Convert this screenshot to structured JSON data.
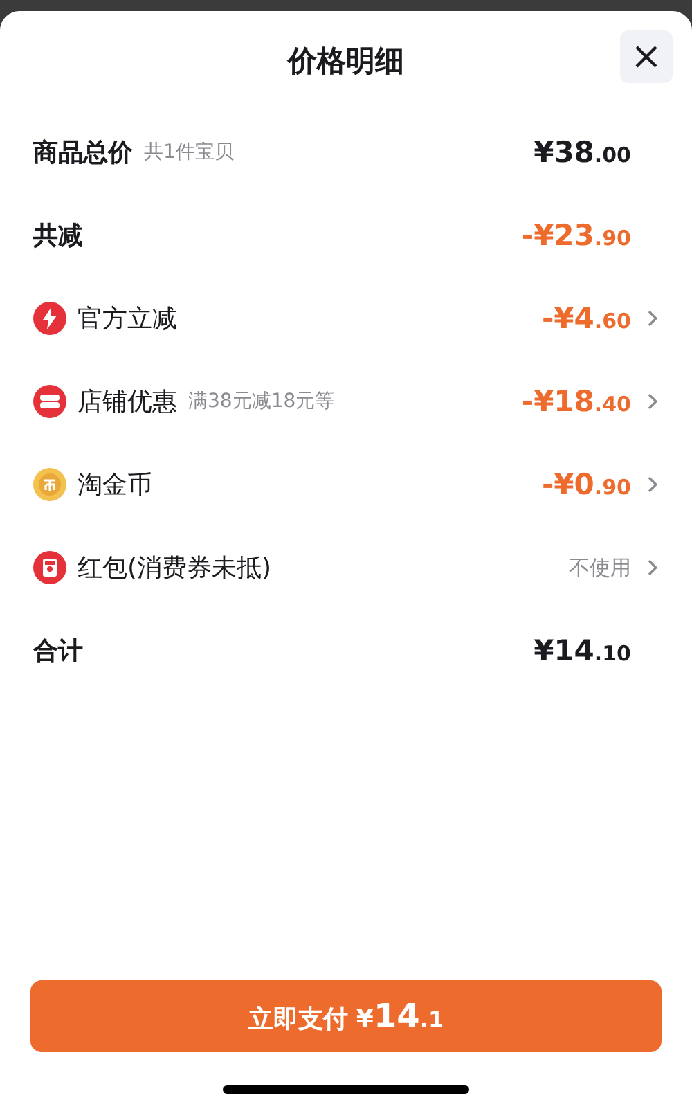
{
  "title": "价格明细",
  "rows": [
    {
      "kind": "summary",
      "label": "商品总价",
      "note": "共1件宝贝",
      "amount": {
        "main": "¥38",
        "fraction": ".00"
      },
      "color": "#1b1b1f",
      "chevron": false
    },
    {
      "kind": "summary",
      "label": "共减",
      "amount": {
        "main": "-¥23",
        "fraction": ".90"
      },
      "color": "#ec6b2d",
      "chevron": false
    },
    {
      "kind": "official",
      "label": "官方立减",
      "amount": {
        "main": "-¥4",
        "fraction": ".60"
      },
      "color": "#ec6b2d",
      "chevron": true
    },
    {
      "kind": "shop",
      "label": "店铺优惠",
      "note": "满38元减18元等",
      "amount": {
        "main": "-¥18",
        "fraction": ".40"
      },
      "color": "#ec6b2d",
      "chevron": true
    },
    {
      "kind": "coin",
      "label": "淘金币",
      "amount": {
        "main": "-¥0",
        "fraction": ".90"
      },
      "color": "#ec6b2d",
      "chevron": true
    },
    {
      "kind": "packet",
      "label": "红包(消费券未抵)",
      "value": "不使用",
      "chevron": true
    },
    {
      "kind": "summary",
      "label": "合计",
      "amount": {
        "main": "¥14",
        "fraction": ".10"
      },
      "color": "#1b1b1f",
      "chevron": false
    }
  ],
  "pay_button": {
    "label": "立即支付",
    "amount": {
      "main": "¥14",
      "fraction": ".1"
    }
  }
}
